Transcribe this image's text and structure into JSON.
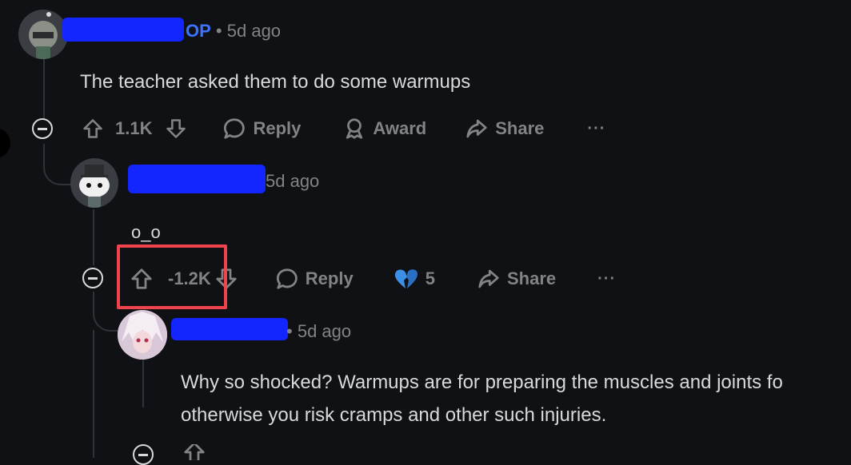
{
  "comment1": {
    "op_label": "OP",
    "time": "5d ago",
    "text": "The teacher asked them to do some warmups",
    "actions": {
      "upvotes": "1.1K",
      "reply": "Reply",
      "award": "Award",
      "share": "Share",
      "more": "···"
    }
  },
  "comment2": {
    "time": "5d ago",
    "text": "o_o",
    "actions": {
      "upvotes": "-1.2K",
      "reply": "Reply",
      "award_count": "5",
      "share": "Share",
      "more": "···"
    }
  },
  "comment3": {
    "time": "5d ago",
    "text_line1": "Why so shocked? Warmups are for preparing the muscles and joints fo",
    "text_line2": "otherwise you risk cramps and other such injuries."
  },
  "colors": {
    "highlight": "#f0444c",
    "op": "#3b74ff",
    "redaction": "#1326ff"
  }
}
